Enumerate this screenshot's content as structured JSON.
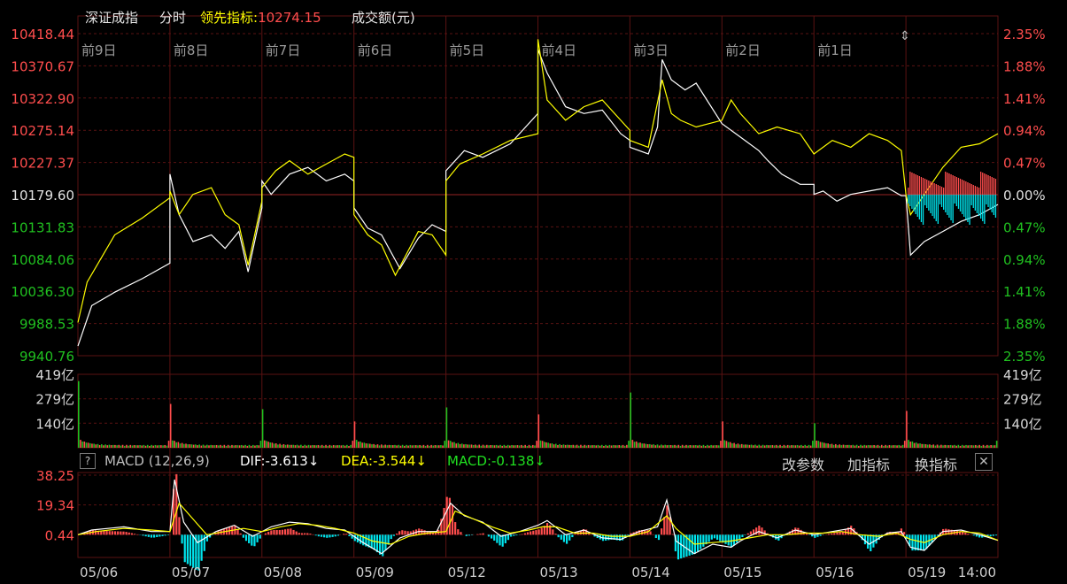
{
  "header": {
    "index_name": "深证成指",
    "mode": "分时",
    "leader_label": "领先指标:",
    "leader_value": "10274.15",
    "volume_label": "成交额(元)"
  },
  "macd_panel": {
    "help": "?",
    "title": "MACD (12,26,9)",
    "dif": "DIF:-3.613↓",
    "dea": "DEA:-3.544↓",
    "macd": "MACD:-0.138↓",
    "buttons": [
      "改参数",
      "加指标",
      "换指标"
    ],
    "close": "✕"
  },
  "colors": {
    "up": "#ff4d4d",
    "down": "#20c020",
    "index_line": "#ffffff",
    "leader_line": "#ffff00",
    "macd_down": "#00e5ee",
    "grid": "#5a1212"
  },
  "chart_data": [
    {
      "type": "line",
      "name": "price",
      "ylim": [
        9940.76,
        10418.44
      ],
      "yticks_left": [
        "10418.44",
        "10370.67",
        "10322.90",
        "10275.14",
        "10227.37",
        "10179.60",
        "10131.83",
        "10084.06",
        "10036.30",
        "9988.53",
        "9940.76"
      ],
      "yticks_right": [
        "2.35%",
        "1.88%",
        "1.41%",
        "0.94%",
        "0.47%",
        "0.00%",
        "0.47%",
        "0.94%",
        "1.41%",
        "1.88%",
        "2.35%"
      ],
      "day_labels": [
        "前9日",
        "前8日",
        "前7日",
        "前6日",
        "前5日",
        "前4日",
        "前3日",
        "前2日",
        "前1日",
        ""
      ],
      "series": [
        {
          "key": "index",
          "points": [
            [
              0.0,
              9955
            ],
            [
              0.15,
              10015
            ],
            [
              0.4,
              10035
            ],
            [
              0.7,
              10055
            ],
            [
              1.0,
              10078
            ],
            [
              1.0,
              10210
            ],
            [
              1.1,
              10150
            ],
            [
              1.25,
              10110
            ],
            [
              1.45,
              10120
            ],
            [
              1.6,
              10100
            ],
            [
              1.75,
              10125
            ],
            [
              1.85,
              10065
            ],
            [
              2.0,
              10160
            ],
            [
              2.0,
              10200
            ],
            [
              2.1,
              10180
            ],
            [
              2.3,
              10210
            ],
            [
              2.5,
              10220
            ],
            [
              2.7,
              10200
            ],
            [
              2.9,
              10210
            ],
            [
              3.0,
              10200
            ],
            [
              3.0,
              10160
            ],
            [
              3.15,
              10130
            ],
            [
              3.3,
              10120
            ],
            [
              3.5,
              10070
            ],
            [
              3.7,
              10115
            ],
            [
              3.85,
              10135
            ],
            [
              4.0,
              10125
            ],
            [
              4.0,
              10215
            ],
            [
              4.2,
              10245
            ],
            [
              4.4,
              10235
            ],
            [
              4.7,
              10255
            ],
            [
              5.0,
              10300
            ],
            [
              5.0,
              10395
            ],
            [
              5.1,
              10360
            ],
            [
              5.3,
              10310
            ],
            [
              5.5,
              10300
            ],
            [
              5.7,
              10305
            ],
            [
              5.9,
              10270
            ],
            [
              6.0,
              10260
            ],
            [
              6.0,
              10250
            ],
            [
              6.2,
              10240
            ],
            [
              6.3,
              10280
            ],
            [
              6.35,
              10380
            ],
            [
              6.45,
              10350
            ],
            [
              6.6,
              10335
            ],
            [
              6.72,
              10345
            ],
            [
              7.0,
              10285
            ],
            [
              7.2,
              10265
            ],
            [
              7.4,
              10245
            ],
            [
              7.5,
              10230
            ],
            [
              7.65,
              10210
            ],
            [
              7.85,
              10195
            ],
            [
              8.0,
              10195
            ],
            [
              8.0,
              10180
            ],
            [
              8.1,
              10185
            ],
            [
              8.25,
              10170
            ],
            [
              8.4,
              10180
            ],
            [
              8.6,
              10185
            ],
            [
              8.8,
              10190
            ],
            [
              8.95,
              10178
            ],
            [
              9.0,
              10178
            ],
            [
              9.05,
              10090
            ],
            [
              9.2,
              10110
            ],
            [
              9.4,
              10125
            ],
            [
              9.6,
              10140
            ],
            [
              9.8,
              10150
            ],
            [
              10.0,
              10165
            ]
          ]
        },
        {
          "key": "leader",
          "points": [
            [
              0.0,
              9990
            ],
            [
              0.1,
              10050
            ],
            [
              0.4,
              10120
            ],
            [
              0.7,
              10145
            ],
            [
              1.0,
              10175
            ],
            [
              1.0,
              10185
            ],
            [
              1.1,
              10150
            ],
            [
              1.25,
              10180
            ],
            [
              1.45,
              10190
            ],
            [
              1.6,
              10150
            ],
            [
              1.75,
              10135
            ],
            [
              1.85,
              10075
            ],
            [
              2.0,
              10170
            ],
            [
              2.0,
              10190
            ],
            [
              2.15,
              10215
            ],
            [
              2.3,
              10230
            ],
            [
              2.5,
              10210
            ],
            [
              2.7,
              10225
            ],
            [
              2.9,
              10240
            ],
            [
              3.0,
              10235
            ],
            [
              3.0,
              10150
            ],
            [
              3.15,
              10120
            ],
            [
              3.3,
              10105
            ],
            [
              3.45,
              10060
            ],
            [
              3.7,
              10125
            ],
            [
              3.85,
              10120
            ],
            [
              4.0,
              10090
            ],
            [
              4.0,
              10200
            ],
            [
              4.15,
              10225
            ],
            [
              4.4,
              10240
            ],
            [
              4.7,
              10260
            ],
            [
              5.0,
              10270
            ],
            [
              5.0,
              10410
            ],
            [
              5.1,
              10320
            ],
            [
              5.3,
              10290
            ],
            [
              5.5,
              10310
            ],
            [
              5.7,
              10320
            ],
            [
              5.9,
              10290
            ],
            [
              6.0,
              10275
            ],
            [
              6.0,
              10260
            ],
            [
              6.2,
              10250
            ],
            [
              6.35,
              10350
            ],
            [
              6.45,
              10300
            ],
            [
              6.55,
              10290
            ],
            [
              6.72,
              10280
            ],
            [
              7.0,
              10290
            ],
            [
              7.1,
              10320
            ],
            [
              7.2,
              10300
            ],
            [
              7.4,
              10270
            ],
            [
              7.6,
              10280
            ],
            [
              7.85,
              10270
            ],
            [
              8.0,
              10240
            ],
            [
              8.2,
              10260
            ],
            [
              8.4,
              10250
            ],
            [
              8.6,
              10270
            ],
            [
              8.8,
              10260
            ],
            [
              8.95,
              10245
            ],
            [
              9.0,
              10180
            ],
            [
              9.05,
              10150
            ],
            [
              9.2,
              10180
            ],
            [
              9.4,
              10220
            ],
            [
              9.6,
              10250
            ],
            [
              9.8,
              10255
            ],
            [
              10.0,
              10270
            ]
          ]
        }
      ]
    },
    {
      "type": "bar",
      "name": "turnover",
      "unit": "亿",
      "ylim": [
        0,
        419
      ],
      "yticks": [
        "419亿",
        "279亿",
        "140亿"
      ],
      "day_open_peaks": [
        300,
        170,
        140,
        70,
        150,
        110,
        235,
        70,
        60,
        130,
        40
      ]
    },
    {
      "type": "line",
      "name": "macd",
      "ylim": [
        -14,
        38.25
      ],
      "yticks": [
        "38.25",
        "19.34",
        "0.44"
      ],
      "series": [
        {
          "key": "dif",
          "points": [
            [
              0.0,
              0
            ],
            [
              0.15,
              3
            ],
            [
              0.5,
              5
            ],
            [
              0.8,
              2
            ],
            [
              1.0,
              2
            ],
            [
              1.05,
              35
            ],
            [
              1.15,
              8
            ],
            [
              1.3,
              -5
            ],
            [
              1.5,
              2
            ],
            [
              1.7,
              6
            ],
            [
              1.9,
              -1
            ],
            [
              2.1,
              5
            ],
            [
              2.3,
              8
            ],
            [
              2.5,
              7
            ],
            [
              2.7,
              4
            ],
            [
              2.9,
              3
            ],
            [
              3.1,
              -5
            ],
            [
              3.3,
              -12
            ],
            [
              3.5,
              -2
            ],
            [
              3.7,
              2
            ],
            [
              3.9,
              2
            ],
            [
              4.05,
              20
            ],
            [
              4.2,
              12
            ],
            [
              4.4,
              8
            ],
            [
              4.6,
              -1
            ],
            [
              4.8,
              2
            ],
            [
              5.0,
              6
            ],
            [
              5.1,
              9
            ],
            [
              5.3,
              0
            ],
            [
              5.5,
              3
            ],
            [
              5.7,
              -2
            ],
            [
              5.9,
              -3
            ],
            [
              6.1,
              2
            ],
            [
              6.3,
              5
            ],
            [
              6.4,
              22
            ],
            [
              6.5,
              -4
            ],
            [
              6.7,
              -12
            ],
            [
              6.9,
              -6
            ],
            [
              7.1,
              -8
            ],
            [
              7.2,
              -4
            ],
            [
              7.4,
              2
            ],
            [
              7.6,
              -2
            ],
            [
              7.8,
              3
            ],
            [
              8.0,
              0
            ],
            [
              8.2,
              2
            ],
            [
              8.4,
              4
            ],
            [
              8.6,
              -6
            ],
            [
              8.8,
              1
            ],
            [
              8.95,
              2
            ],
            [
              9.05,
              -8
            ],
            [
              9.2,
              -10
            ],
            [
              9.4,
              2
            ],
            [
              9.6,
              3
            ],
            [
              9.8,
              0
            ],
            [
              10.0,
              -3.6
            ]
          ]
        },
        {
          "key": "dea",
          "points": [
            [
              0.0,
              0
            ],
            [
              0.2,
              2
            ],
            [
              0.5,
              4
            ],
            [
              0.8,
              3
            ],
            [
              1.0,
              2
            ],
            [
              1.1,
              20
            ],
            [
              1.25,
              10
            ],
            [
              1.4,
              0
            ],
            [
              1.6,
              2
            ],
            [
              1.8,
              4
            ],
            [
              2.0,
              2
            ],
            [
              2.2,
              5
            ],
            [
              2.4,
              7
            ],
            [
              2.6,
              6
            ],
            [
              2.8,
              4
            ],
            [
              3.0,
              1
            ],
            [
              3.2,
              -4
            ],
            [
              3.4,
              -6
            ],
            [
              3.6,
              -1
            ],
            [
              3.8,
              1
            ],
            [
              4.0,
              2
            ],
            [
              4.1,
              15
            ],
            [
              4.3,
              10
            ],
            [
              4.5,
              5
            ],
            [
              4.7,
              1
            ],
            [
              4.9,
              3
            ],
            [
              5.05,
              5
            ],
            [
              5.2,
              5
            ],
            [
              5.4,
              1
            ],
            [
              5.6,
              1
            ],
            [
              5.8,
              -1
            ],
            [
              6.0,
              -1
            ],
            [
              6.2,
              2
            ],
            [
              6.4,
              12
            ],
            [
              6.5,
              4
            ],
            [
              6.7,
              -6
            ],
            [
              6.9,
              -5
            ],
            [
              7.1,
              -4
            ],
            [
              7.3,
              -2
            ],
            [
              7.5,
              0
            ],
            [
              7.7,
              0
            ],
            [
              7.9,
              1
            ],
            [
              8.1,
              1
            ],
            [
              8.3,
              2
            ],
            [
              8.5,
              0
            ],
            [
              8.7,
              -1
            ],
            [
              8.9,
              1
            ],
            [
              9.05,
              -3
            ],
            [
              9.2,
              -5
            ],
            [
              9.4,
              0
            ],
            [
              9.6,
              2
            ],
            [
              9.8,
              1
            ],
            [
              10.0,
              -3.5
            ]
          ]
        }
      ]
    }
  ],
  "x_axis": {
    "labels": [
      "05/06",
      "05/07",
      "05/08",
      "05/09",
      "05/12",
      "05/13",
      "05/14",
      "05/15",
      "05/16",
      "05/19"
    ],
    "end_time": "14:00"
  }
}
